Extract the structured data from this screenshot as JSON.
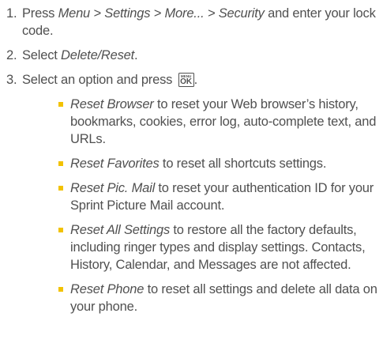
{
  "steps": [
    {
      "number": "1.",
      "parts": {
        "a": "Press ",
        "b": "Menu",
        "c": " > ",
        "d": "Settings",
        "e": " > ",
        "f": "More...",
        "g": " > ",
        "h": "Security",
        "i": " and enter your lock code."
      }
    },
    {
      "number": "2.",
      "parts": {
        "a": "Select ",
        "b": "Delete/Reset",
        "c": "."
      }
    },
    {
      "number": "3.",
      "parts": {
        "a": "Select an option and press ",
        "b": "."
      },
      "key": {
        "top": "MENU",
        "bottom": "OK",
        "icon": "menu-ok-key-icon"
      }
    }
  ],
  "options": [
    {
      "name": "Reset Browser",
      "desc": " to reset your Web browser’s history, bookmarks, cookies, error log, auto-complete text, and URLs."
    },
    {
      "name": "Reset Favorites",
      "desc": " to reset all shortcuts settings."
    },
    {
      "name": "Reset Pic. Mail",
      "desc": " to reset your authentication ID for your Sprint Picture Mail account."
    },
    {
      "name": "Reset All Settings",
      "desc": " to restore all the factory defaults, including ringer types and display settings. Contacts, History, Calendar, and Messages are not affected."
    },
    {
      "name": "Reset Phone",
      "desc": " to reset all settings and delete all data on your phone."
    }
  ],
  "colors": {
    "text": "#505050",
    "bullet": "#f2c200"
  }
}
